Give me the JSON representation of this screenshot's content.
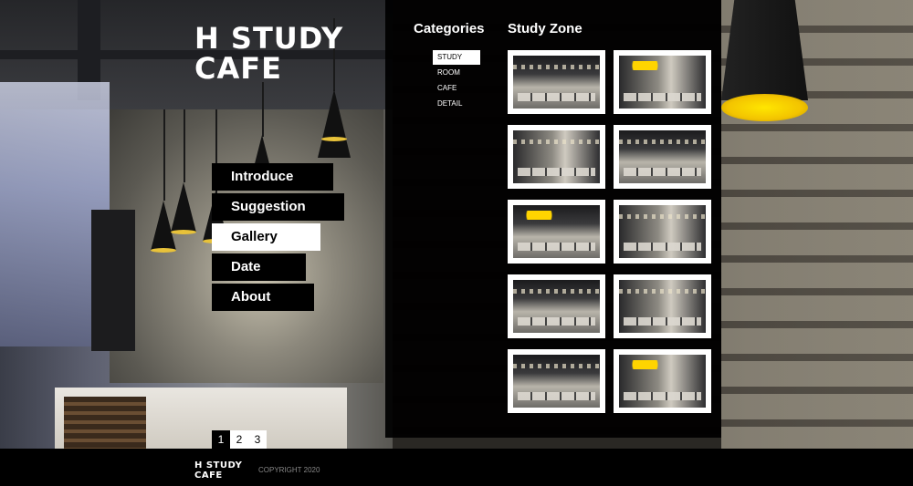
{
  "logo": {
    "line1": "H STUDY",
    "line2": "CAFE"
  },
  "nav": {
    "items": [
      {
        "label": "Introduce",
        "active": false
      },
      {
        "label": "Suggestion",
        "active": false
      },
      {
        "label": "Gallery",
        "active": true
      },
      {
        "label": "Date",
        "active": false
      },
      {
        "label": "About",
        "active": false
      }
    ]
  },
  "pager": {
    "pages": [
      "1",
      "2",
      "3"
    ],
    "current": "1"
  },
  "categories": {
    "title": "Categories",
    "items": [
      "STUDY",
      "ROOM",
      "CAFE",
      "DETAIL"
    ],
    "active": "STUDY"
  },
  "gallery": {
    "title": "Study Zone",
    "thumbnail_count": 10
  },
  "footer": {
    "logo_line1": "H STUDY",
    "logo_line2": "CAFE",
    "copyright": "COPYRIGHT 2020"
  },
  "colors": {
    "accent_yellow": "#f3c400",
    "panel_bg": "#000000",
    "active_bg": "#ffffff"
  }
}
